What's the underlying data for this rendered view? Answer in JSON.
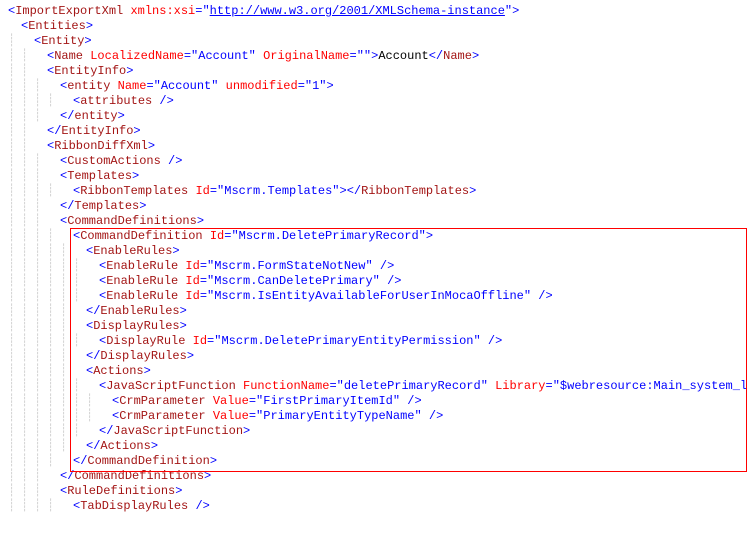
{
  "lines": [
    {
      "guides": "",
      "indent": 0,
      "tokens": [
        {
          "c": "p",
          "s": "<"
        },
        {
          "c": "t",
          "s": "ImportExportXml"
        },
        {
          "c": "txt",
          "s": " "
        },
        {
          "c": "a",
          "s": "xmlns:xsi"
        },
        {
          "c": "p",
          "s": "="
        },
        {
          "c": "p",
          "s": "\""
        },
        {
          "c": "link",
          "s": "http://www.w3.org/2001/XMLSchema-instance"
        },
        {
          "c": "p",
          "s": "\""
        },
        {
          "c": "p",
          "s": ">"
        }
      ]
    },
    {
      "guides": "",
      "indent": 1,
      "tokens": [
        {
          "c": "p",
          "s": "<"
        },
        {
          "c": "t",
          "s": "Entities"
        },
        {
          "c": "p",
          "s": ">"
        }
      ]
    },
    {
      "guides": "│",
      "indent": 2,
      "tokens": [
        {
          "c": "p",
          "s": "<"
        },
        {
          "c": "t",
          "s": "Entity"
        },
        {
          "c": "p",
          "s": ">"
        }
      ]
    },
    {
      "guides": "││",
      "indent": 3,
      "tokens": [
        {
          "c": "p",
          "s": "<"
        },
        {
          "c": "t",
          "s": "Name"
        },
        {
          "c": "txt",
          "s": " "
        },
        {
          "c": "a",
          "s": "LocalizedName"
        },
        {
          "c": "p",
          "s": "="
        },
        {
          "c": "p",
          "s": "\""
        },
        {
          "c": "v",
          "s": "Account"
        },
        {
          "c": "p",
          "s": "\""
        },
        {
          "c": "txt",
          "s": " "
        },
        {
          "c": "a",
          "s": "OriginalName"
        },
        {
          "c": "p",
          "s": "="
        },
        {
          "c": "p",
          "s": "\""
        },
        {
          "c": "p",
          "s": "\""
        },
        {
          "c": "p",
          "s": ">"
        },
        {
          "c": "txt",
          "s": "Account"
        },
        {
          "c": "p",
          "s": "</"
        },
        {
          "c": "t",
          "s": "Name"
        },
        {
          "c": "p",
          "s": ">"
        }
      ]
    },
    {
      "guides": "││",
      "indent": 3,
      "tokens": [
        {
          "c": "p",
          "s": "<"
        },
        {
          "c": "t",
          "s": "EntityInfo"
        },
        {
          "c": "p",
          "s": ">"
        }
      ]
    },
    {
      "guides": "│││",
      "indent": 4,
      "tokens": [
        {
          "c": "p",
          "s": "<"
        },
        {
          "c": "t",
          "s": "entity"
        },
        {
          "c": "txt",
          "s": " "
        },
        {
          "c": "a",
          "s": "Name"
        },
        {
          "c": "p",
          "s": "="
        },
        {
          "c": "p",
          "s": "\""
        },
        {
          "c": "v",
          "s": "Account"
        },
        {
          "c": "p",
          "s": "\""
        },
        {
          "c": "txt",
          "s": " "
        },
        {
          "c": "a",
          "s": "unmodified"
        },
        {
          "c": "p",
          "s": "="
        },
        {
          "c": "p",
          "s": "\""
        },
        {
          "c": "v",
          "s": "1"
        },
        {
          "c": "p",
          "s": "\""
        },
        {
          "c": "p",
          "s": ">"
        }
      ]
    },
    {
      "guides": "││││",
      "indent": 5,
      "tokens": [
        {
          "c": "p",
          "s": "<"
        },
        {
          "c": "t",
          "s": "attributes"
        },
        {
          "c": "txt",
          "s": " "
        },
        {
          "c": "p",
          "s": "/>"
        }
      ]
    },
    {
      "guides": "│││",
      "indent": 4,
      "tokens": [
        {
          "c": "p",
          "s": "</"
        },
        {
          "c": "t",
          "s": "entity"
        },
        {
          "c": "p",
          "s": ">"
        }
      ]
    },
    {
      "guides": "││",
      "indent": 3,
      "tokens": [
        {
          "c": "p",
          "s": "</"
        },
        {
          "c": "t",
          "s": "EntityInfo"
        },
        {
          "c": "p",
          "s": ">"
        }
      ]
    },
    {
      "guides": "││",
      "indent": 3,
      "tokens": [
        {
          "c": "p",
          "s": "<"
        },
        {
          "c": "t",
          "s": "RibbonDiffXml"
        },
        {
          "c": "p",
          "s": ">"
        }
      ]
    },
    {
      "guides": "│││",
      "indent": 4,
      "tokens": [
        {
          "c": "p",
          "s": "<"
        },
        {
          "c": "t",
          "s": "CustomActions"
        },
        {
          "c": "txt",
          "s": " "
        },
        {
          "c": "p",
          "s": "/>"
        }
      ]
    },
    {
      "guides": "│││",
      "indent": 4,
      "tokens": [
        {
          "c": "p",
          "s": "<"
        },
        {
          "c": "t",
          "s": "Templates"
        },
        {
          "c": "p",
          "s": ">"
        }
      ]
    },
    {
      "guides": "││││",
      "indent": 5,
      "tokens": [
        {
          "c": "p",
          "s": "<"
        },
        {
          "c": "t",
          "s": "RibbonTemplates"
        },
        {
          "c": "txt",
          "s": " "
        },
        {
          "c": "a",
          "s": "Id"
        },
        {
          "c": "p",
          "s": "="
        },
        {
          "c": "p",
          "s": "\""
        },
        {
          "c": "v",
          "s": "Mscrm.Templates"
        },
        {
          "c": "p",
          "s": "\""
        },
        {
          "c": "p",
          "s": ">"
        },
        {
          "c": "p",
          "s": "</"
        },
        {
          "c": "t",
          "s": "RibbonTemplates"
        },
        {
          "c": "p",
          "s": ">"
        }
      ]
    },
    {
      "guides": "│││",
      "indent": 4,
      "tokens": [
        {
          "c": "p",
          "s": "</"
        },
        {
          "c": "t",
          "s": "Templates"
        },
        {
          "c": "p",
          "s": ">"
        }
      ]
    },
    {
      "guides": "│││",
      "indent": 4,
      "tokens": [
        {
          "c": "p",
          "s": "<"
        },
        {
          "c": "t",
          "s": "CommandDefinitions"
        },
        {
          "c": "p",
          "s": ">"
        }
      ]
    },
    {
      "guides": "││││",
      "indent": 5,
      "tokens": [
        {
          "c": "p",
          "s": "<"
        },
        {
          "c": "t",
          "s": "CommandDefinition"
        },
        {
          "c": "txt",
          "s": " "
        },
        {
          "c": "a",
          "s": "Id"
        },
        {
          "c": "p",
          "s": "="
        },
        {
          "c": "p",
          "s": "\""
        },
        {
          "c": "v",
          "s": "Mscrm.DeletePrimaryRecord"
        },
        {
          "c": "p",
          "s": "\""
        },
        {
          "c": "p",
          "s": ">"
        }
      ]
    },
    {
      "guides": "│││││",
      "indent": 6,
      "tokens": [
        {
          "c": "p",
          "s": "<"
        },
        {
          "c": "t",
          "s": "EnableRules"
        },
        {
          "c": "p",
          "s": ">"
        }
      ]
    },
    {
      "guides": "││││││",
      "indent": 7,
      "tokens": [
        {
          "c": "p",
          "s": "<"
        },
        {
          "c": "t",
          "s": "EnableRule"
        },
        {
          "c": "txt",
          "s": " "
        },
        {
          "c": "a",
          "s": "Id"
        },
        {
          "c": "p",
          "s": "="
        },
        {
          "c": "p",
          "s": "\""
        },
        {
          "c": "v",
          "s": "Mscrm.FormStateNotNew"
        },
        {
          "c": "p",
          "s": "\""
        },
        {
          "c": "txt",
          "s": " "
        },
        {
          "c": "p",
          "s": "/>"
        }
      ]
    },
    {
      "guides": "││││││",
      "indent": 7,
      "tokens": [
        {
          "c": "p",
          "s": "<"
        },
        {
          "c": "t",
          "s": "EnableRule"
        },
        {
          "c": "txt",
          "s": " "
        },
        {
          "c": "a",
          "s": "Id"
        },
        {
          "c": "p",
          "s": "="
        },
        {
          "c": "p",
          "s": "\""
        },
        {
          "c": "v",
          "s": "Mscrm.CanDeletePrimary"
        },
        {
          "c": "p",
          "s": "\""
        },
        {
          "c": "txt",
          "s": " "
        },
        {
          "c": "p",
          "s": "/>"
        }
      ]
    },
    {
      "guides": "││││││",
      "indent": 7,
      "tokens": [
        {
          "c": "p",
          "s": "<"
        },
        {
          "c": "t",
          "s": "EnableRule"
        },
        {
          "c": "txt",
          "s": " "
        },
        {
          "c": "a",
          "s": "Id"
        },
        {
          "c": "p",
          "s": "="
        },
        {
          "c": "p",
          "s": "\""
        },
        {
          "c": "v",
          "s": "Mscrm.IsEntityAvailableForUserInMocaOffline"
        },
        {
          "c": "p",
          "s": "\""
        },
        {
          "c": "txt",
          "s": " "
        },
        {
          "c": "p",
          "s": "/>"
        }
      ]
    },
    {
      "guides": "│││││",
      "indent": 6,
      "tokens": [
        {
          "c": "p",
          "s": "</"
        },
        {
          "c": "t",
          "s": "EnableRules"
        },
        {
          "c": "p",
          "s": ">"
        }
      ]
    },
    {
      "guides": "│││││",
      "indent": 6,
      "tokens": [
        {
          "c": "p",
          "s": "<"
        },
        {
          "c": "t",
          "s": "DisplayRules"
        },
        {
          "c": "p",
          "s": ">"
        }
      ]
    },
    {
      "guides": "││││││",
      "indent": 7,
      "tokens": [
        {
          "c": "p",
          "s": "<"
        },
        {
          "c": "t",
          "s": "DisplayRule"
        },
        {
          "c": "txt",
          "s": " "
        },
        {
          "c": "a",
          "s": "Id"
        },
        {
          "c": "p",
          "s": "="
        },
        {
          "c": "p",
          "s": "\""
        },
        {
          "c": "v",
          "s": "Mscrm.DeletePrimaryEntityPermission"
        },
        {
          "c": "p",
          "s": "\""
        },
        {
          "c": "txt",
          "s": " "
        },
        {
          "c": "p",
          "s": "/>"
        }
      ]
    },
    {
      "guides": "│││││",
      "indent": 6,
      "tokens": [
        {
          "c": "p",
          "s": "</"
        },
        {
          "c": "t",
          "s": "DisplayRules"
        },
        {
          "c": "p",
          "s": ">"
        }
      ]
    },
    {
      "guides": "│││││",
      "indent": 6,
      "tokens": [
        {
          "c": "p",
          "s": "<"
        },
        {
          "c": "t",
          "s": "Actions"
        },
        {
          "c": "p",
          "s": ">"
        }
      ]
    },
    {
      "guides": "││││││",
      "indent": 7,
      "tokens": [
        {
          "c": "p",
          "s": "<"
        },
        {
          "c": "t",
          "s": "JavaScriptFunction"
        },
        {
          "c": "txt",
          "s": " "
        },
        {
          "c": "a",
          "s": "FunctionName"
        },
        {
          "c": "p",
          "s": "="
        },
        {
          "c": "p",
          "s": "\""
        },
        {
          "c": "v",
          "s": "deletePrimaryRecord"
        },
        {
          "c": "p",
          "s": "\""
        },
        {
          "c": "txt",
          "s": " "
        },
        {
          "c": "a",
          "s": "Library"
        },
        {
          "c": "p",
          "s": "="
        },
        {
          "c": "p",
          "s": "\""
        },
        {
          "c": "v",
          "s": "$webresource:Main_system_library.js"
        },
        {
          "c": "p",
          "s": "\""
        },
        {
          "c": "p",
          "s": ">"
        }
      ]
    },
    {
      "guides": "│││││││",
      "indent": 8,
      "tokens": [
        {
          "c": "p",
          "s": "<"
        },
        {
          "c": "t",
          "s": "CrmParameter"
        },
        {
          "c": "txt",
          "s": " "
        },
        {
          "c": "a",
          "s": "Value"
        },
        {
          "c": "p",
          "s": "="
        },
        {
          "c": "p",
          "s": "\""
        },
        {
          "c": "v",
          "s": "FirstPrimaryItemId"
        },
        {
          "c": "p",
          "s": "\""
        },
        {
          "c": "txt",
          "s": " "
        },
        {
          "c": "p",
          "s": "/>"
        }
      ]
    },
    {
      "guides": "│││││││",
      "indent": 8,
      "tokens": [
        {
          "c": "p",
          "s": "<"
        },
        {
          "c": "t",
          "s": "CrmParameter"
        },
        {
          "c": "txt",
          "s": " "
        },
        {
          "c": "a",
          "s": "Value"
        },
        {
          "c": "p",
          "s": "="
        },
        {
          "c": "p",
          "s": "\""
        },
        {
          "c": "v",
          "s": "PrimaryEntityTypeName"
        },
        {
          "c": "p",
          "s": "\""
        },
        {
          "c": "txt",
          "s": " "
        },
        {
          "c": "p",
          "s": "/>"
        }
      ]
    },
    {
      "guides": "││││││",
      "indent": 7,
      "tokens": [
        {
          "c": "p",
          "s": "</"
        },
        {
          "c": "t",
          "s": "JavaScriptFunction"
        },
        {
          "c": "p",
          "s": ">"
        }
      ]
    },
    {
      "guides": "│││││",
      "indent": 6,
      "tokens": [
        {
          "c": "p",
          "s": "</"
        },
        {
          "c": "t",
          "s": "Actions"
        },
        {
          "c": "p",
          "s": ">"
        }
      ]
    },
    {
      "guides": "││││",
      "indent": 5,
      "tokens": [
        {
          "c": "p",
          "s": "</"
        },
        {
          "c": "t",
          "s": "CommandDefinition"
        },
        {
          "c": "p",
          "s": ">"
        }
      ]
    },
    {
      "guides": "│││",
      "indent": 4,
      "tokens": [
        {
          "c": "p",
          "s": "</"
        },
        {
          "c": "t",
          "s": "CommandDefinitions"
        },
        {
          "c": "p",
          "s": ">"
        }
      ]
    },
    {
      "guides": "│││",
      "indent": 4,
      "tokens": [
        {
          "c": "p",
          "s": "<"
        },
        {
          "c": "t",
          "s": "RuleDefinitions"
        },
        {
          "c": "p",
          "s": ">"
        }
      ]
    },
    {
      "guides": "││││",
      "indent": 5,
      "tokens": [
        {
          "c": "p",
          "s": "<"
        },
        {
          "c": "t",
          "s": "TabDisplayRules"
        },
        {
          "c": "txt",
          "s": " "
        },
        {
          "c": "p",
          "s": "/>"
        }
      ]
    }
  ],
  "highlight": {
    "startLine": 15,
    "endLine": 30
  }
}
